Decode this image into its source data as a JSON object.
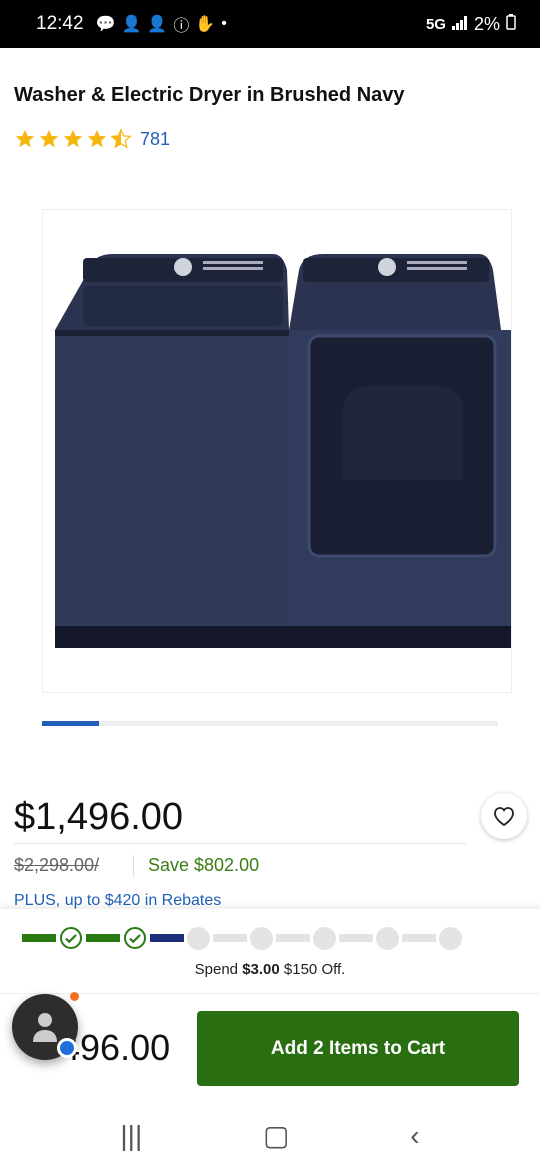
{
  "status_bar": {
    "time": "12:42",
    "network": "5G",
    "battery": "2%",
    "icons": [
      "chat-icon",
      "person-add-icon",
      "person-add-icon",
      "info-icon",
      "hand-icon",
      "dot-icon"
    ]
  },
  "product": {
    "title": "Washer & Electric Dryer in Brushed Navy",
    "rating_value": 4.5,
    "rating_count": "781",
    "image_alt_colors": {
      "appliance": "#262e45",
      "background": "#ffffff"
    },
    "carousel_progress": 0.125
  },
  "pricing": {
    "price": "$1,496.00",
    "was_price": "$2,298.00/",
    "save": "Save $802.00",
    "rebates": "PLUS, up to $420 in Rebates"
  },
  "promo": {
    "spend_prefix": "Spend ",
    "spend_amount": "$3.00",
    "spend_suffix": " $150 Off.",
    "completed_steps": 2
  },
  "cart_bar": {
    "price_visible": "496.00",
    "add_button": "Add 2 Items to Cart"
  },
  "colors": {
    "brand_green": "#2a6e12",
    "link_blue": "#1f5fb8",
    "save_green": "#3a7d14",
    "star_gold": "#f5b70f"
  }
}
